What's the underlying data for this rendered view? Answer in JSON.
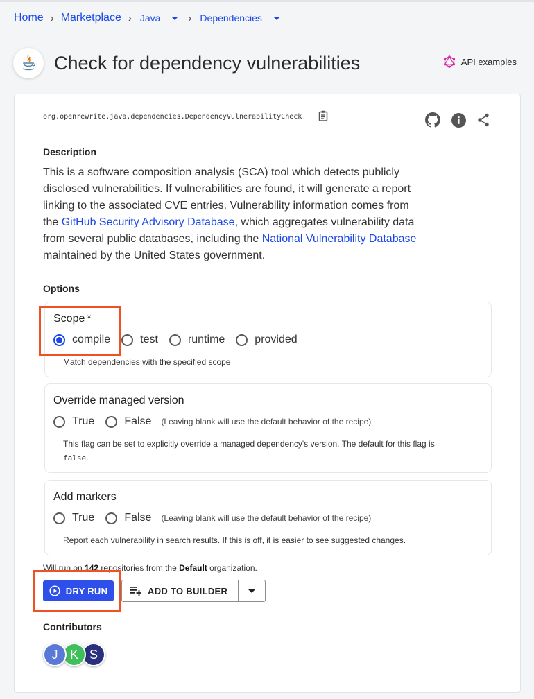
{
  "breadcrumb": {
    "home": "Home",
    "marketplace": "Marketplace",
    "language": "Java",
    "category": "Dependencies"
  },
  "header": {
    "title": "Check for dependency vulnerabilities",
    "api_examples": "API examples"
  },
  "recipe": {
    "id": "org.openrewrite.java.dependencies.DependencyVulnerabilityCheck"
  },
  "description": {
    "heading": "Description",
    "text_1": "This is a software composition analysis (SCA) tool which detects publicly disclosed vulnerabilities. If vulnerabilities are found, it will generate a report linking to the associated CVE entries. Vulnerability information comes from the ",
    "link_1": "GitHub Security Advisory Database",
    "text_2": ", which aggregates vulnerability data from several public databases, including the ",
    "link_2": "National Vulnerability Database",
    "text_3": " maintained by the United States government."
  },
  "options": {
    "heading": "Options",
    "scope": {
      "label": "Scope",
      "required": "*",
      "choices": [
        "compile",
        "test",
        "runtime",
        "provided"
      ],
      "selected": "compile",
      "help": "Match dependencies with the specified scope"
    },
    "override": {
      "label": "Override managed version",
      "true_label": "True",
      "false_label": "False",
      "hint": "(Leaving blank will use the default behavior of the recipe)",
      "help_1": "This flag can be set to explicitly override a managed dependency's version. The default for this flag is",
      "help_code": "false",
      "help_end": "."
    },
    "markers": {
      "label": "Add markers",
      "true_label": "True",
      "false_label": "False",
      "hint": "(Leaving blank will use the default behavior of the recipe)",
      "help": "Report each vulnerability in search results. If this is off, it is easier to see suggested changes."
    }
  },
  "run": {
    "prefix": "Will run on ",
    "count": "142",
    "middle": " repositories from the ",
    "org": "Default",
    "suffix": " organization.",
    "dry_run": "DRY RUN",
    "add_to_builder": "ADD TO BUILDER"
  },
  "contributors": {
    "heading": "Contributors",
    "list": [
      {
        "initial": "J",
        "color": "#5a78d6"
      },
      {
        "initial": "K",
        "color": "#3fbf5a"
      },
      {
        "initial": "S",
        "color": "#2a2f7e"
      }
    ]
  },
  "colors": {
    "accent": "#1a48e8",
    "primary_button": "#2e4fe9",
    "highlight": "#f05123",
    "api_icon": "#d62aa3"
  }
}
